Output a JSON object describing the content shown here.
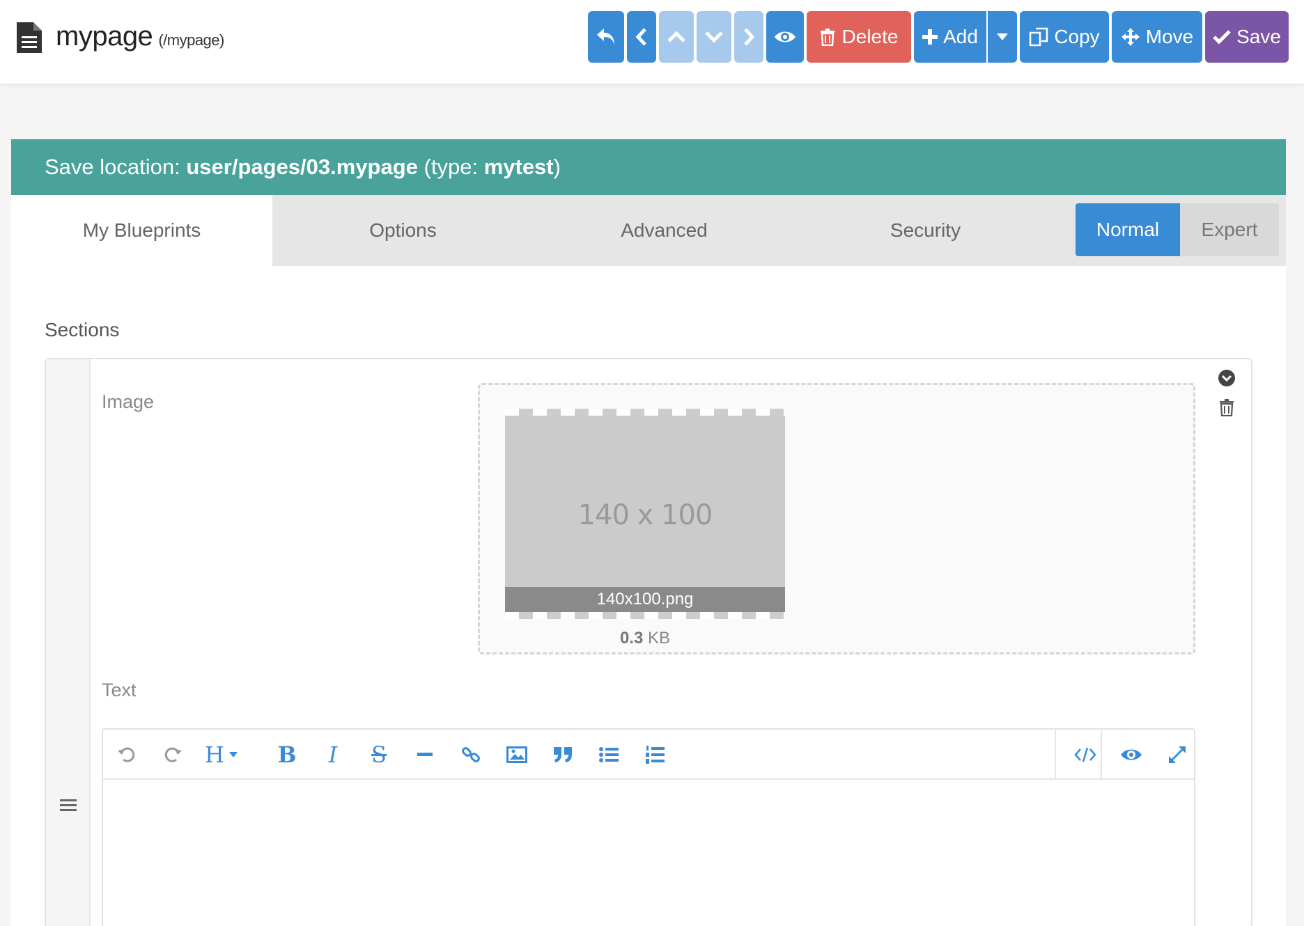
{
  "header": {
    "title": "mypage",
    "route": "(/mypage)",
    "buttons": {
      "delete_label": "Delete",
      "add_label": "Add",
      "copy_label": "Copy",
      "move_label": "Move",
      "save_label": "Save"
    }
  },
  "panel": {
    "save_prefix": "Save location: ",
    "save_path": "user/pages/03.mypage",
    "type_prefix": " (type: ",
    "type_value": "mytest",
    "type_suffix": ")",
    "tabs": [
      {
        "label": "My Blueprints"
      },
      {
        "label": "Options"
      },
      {
        "label": "Advanced"
      },
      {
        "label": "Security"
      }
    ],
    "modes": {
      "normal": "Normal",
      "expert": "Expert"
    },
    "sections_label": "Sections",
    "image_label": "Image",
    "thumb_dims": "140 x 100",
    "thumb_filename": "140x100.png",
    "filesize_value": "0.3",
    "filesize_unit": " KB",
    "text_label": "Text",
    "editor_heading_glyph": "H",
    "editor_bold_glyph": "B",
    "editor_italic_glyph": "I",
    "editor_strike_glyph": "S"
  },
  "colors": {
    "primary": "#3a8bd6",
    "primary_disabled": "#a7c9ec",
    "danger": "#e0625a",
    "save": "#7c56a6",
    "savebar": "#49a39a"
  },
  "icons": [
    "file-icon",
    "undo-icon",
    "chevron-left-icon",
    "chevron-up-icon",
    "chevron-down-icon",
    "chevron-right-icon",
    "eye-icon",
    "trash-icon",
    "plus-icon",
    "caret-down-icon",
    "copy-icon",
    "arrows-move-icon",
    "check-icon",
    "circle-chevron-down-icon",
    "hamburger-icon"
  ]
}
